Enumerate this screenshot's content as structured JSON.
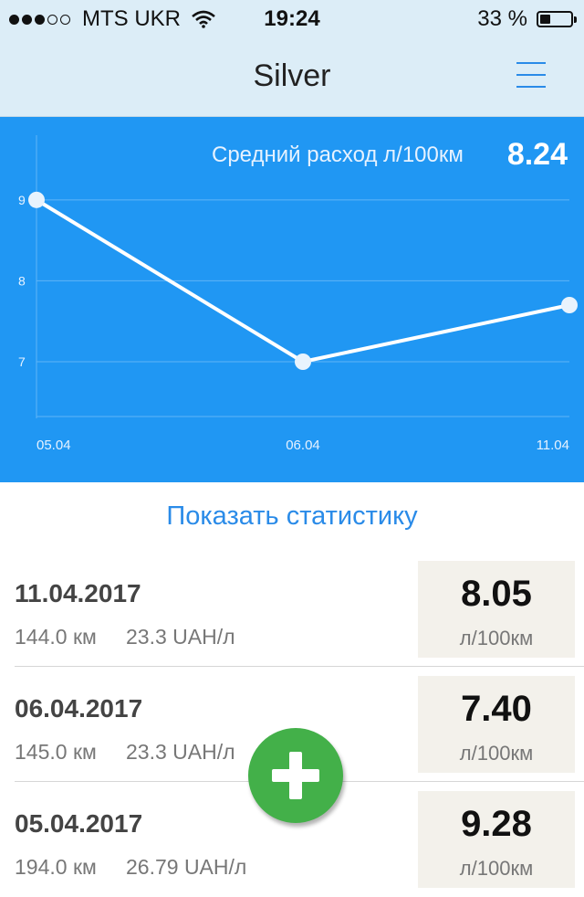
{
  "status_bar": {
    "signal_bars_filled": 3,
    "signal_bars_total": 5,
    "carrier": "MTS UKR",
    "wifi_icon": "wifi-icon",
    "time": "19:24",
    "battery_text": "33 %",
    "battery_level": 0.33
  },
  "nav": {
    "title": "Silver",
    "menu_icon": "hamburger-menu-icon"
  },
  "chart_panel": {
    "avg_label": "Средний расход л/100км",
    "avg_value": "8.24"
  },
  "chart_data": {
    "type": "line",
    "x": [
      "05.04",
      "06.04",
      "11.04"
    ],
    "series": [
      {
        "values": [
          9.0,
          7.0,
          7.7
        ]
      }
    ],
    "y_ticks": [
      "9",
      "8",
      "7"
    ],
    "ylim": [
      6.3,
      9.8
    ],
    "grid": true,
    "colors": {
      "background": "#2097f3",
      "line": "#ffffff",
      "grid": "#5fb5f7"
    }
  },
  "show_stats_label": "Показать статистику",
  "entries": [
    {
      "date": "11.04.2017",
      "km": "144.0 км",
      "price": "23.3 UAH/л",
      "consumption": "8.05",
      "unit": "л/100км"
    },
    {
      "date": "06.04.2017",
      "km": "145.0 км",
      "price": "23.3 UAH/л",
      "consumption": "7.40",
      "unit": "л/100км"
    },
    {
      "date": "05.04.2017",
      "km": "194.0 км",
      "price": "26.79 UAH/л",
      "consumption": "9.28",
      "unit": "л/100км"
    }
  ],
  "fab": {
    "icon": "plus-icon",
    "color": "#43b049"
  },
  "colors": {
    "accent": "#2a8be8",
    "nav_bg": "#dcedf7"
  }
}
